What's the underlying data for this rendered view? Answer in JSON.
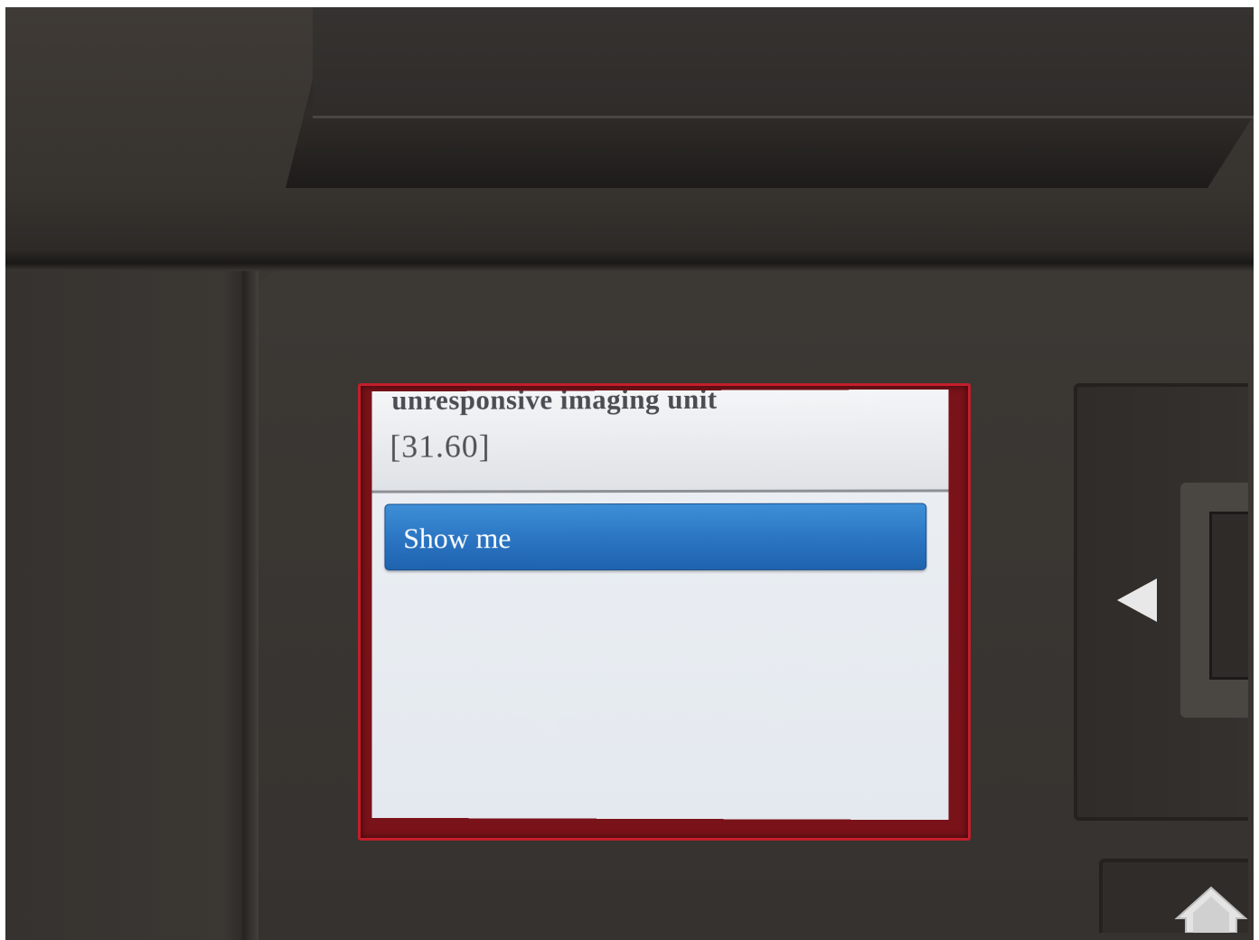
{
  "device_screen": {
    "message_line1": "unresponsive imaging unit",
    "message_line2": "[31.60]",
    "show_me_button": "Show me"
  },
  "hardware": {
    "back_icon": "back-arrow-icon",
    "home_icon": "home-icon"
  },
  "colors": {
    "bezel": "#c41e2a",
    "button": "#2a74c2",
    "housing": "#3a3632"
  }
}
